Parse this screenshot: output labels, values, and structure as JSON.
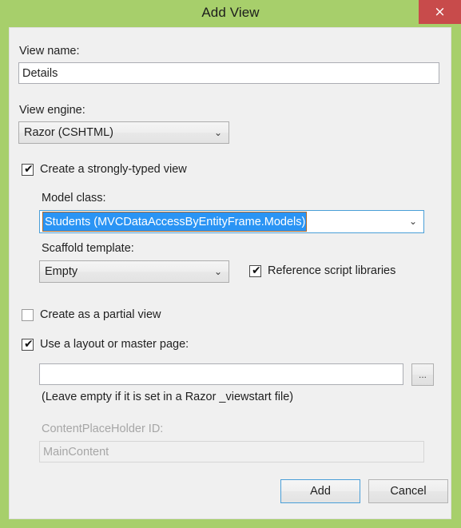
{
  "window": {
    "title": "Add View",
    "close_label": "×",
    "titlebar_color": "#a7cf6b",
    "close_color": "#c84b4b",
    "body_color": "#f0f0f0",
    "accent_color": "#2a94f4"
  },
  "form": {
    "view_name": {
      "label": "View name:",
      "value": "Details"
    },
    "view_engine": {
      "label": "View engine:",
      "value": "Razor (CSHTML)",
      "arrow": "⌄"
    },
    "strongly_typed": {
      "label": "Create a strongly-typed view",
      "checked": true,
      "tick": "✔"
    },
    "model_class": {
      "label": "Model class:",
      "value": "Students (MVCDataAccessByEntityFrame.Models)",
      "arrow": "⌄"
    },
    "scaffold_template": {
      "label": "Scaffold template:",
      "value": "Empty",
      "arrow": "⌄"
    },
    "reference_script_libraries": {
      "label": "Reference script libraries",
      "checked": true,
      "tick": "✔"
    },
    "partial_view": {
      "label": "Create as a partial view",
      "checked": false
    },
    "use_layout": {
      "label": "Use a layout or master page:",
      "checked": true,
      "tick": "✔"
    },
    "layout_path": {
      "value": "",
      "browse_label": "...",
      "hint": "(Leave empty if it is set in a Razor _viewstart file)"
    },
    "content_placeholder": {
      "label": "ContentPlaceHolder ID:",
      "value": "MainContent",
      "disabled": true
    }
  },
  "buttons": {
    "add": "Add",
    "cancel": "Cancel"
  }
}
